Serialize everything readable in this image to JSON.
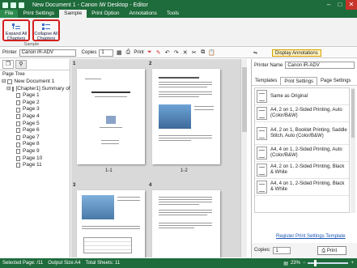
{
  "window": {
    "title": "New Document 1 - Canon iW Desktop - Editor",
    "minimize": "–",
    "maximize": "□",
    "close": "✕"
  },
  "ribbon_tabs": [
    "File",
    "Print Settings",
    "Sample",
    "Print Option",
    "Annotations",
    "Tools"
  ],
  "ribbon": {
    "expand_label": "Expand All Chapters",
    "collapse_label": "Collapse All Chapters",
    "group_label": "Sample"
  },
  "toolbar": {
    "printer_label": "Printer",
    "printer_value": "Canon iR-ADV",
    "copies_label": "Copies",
    "copies_value": "1",
    "print_label": "Print",
    "display_annotations": "Display Annotations"
  },
  "left_panel": {
    "title": "Page Tree",
    "tree": [
      {
        "label": "New Document 1",
        "level": 0
      },
      {
        "label": "[Chapter1] Summary of R",
        "level": 1
      },
      {
        "label": "Page 1",
        "level": 2
      },
      {
        "label": "Page 2",
        "level": 2
      },
      {
        "label": "Page 3",
        "level": 2
      },
      {
        "label": "Page 4",
        "level": 2
      },
      {
        "label": "Page 5",
        "level": 2
      },
      {
        "label": "Page 6",
        "level": 2
      },
      {
        "label": "Page 7",
        "level": 2
      },
      {
        "label": "Page 8",
        "level": 2
      },
      {
        "label": "Page 9",
        "level": 2
      },
      {
        "label": "Page 10",
        "level": 2
      },
      {
        "label": "Page 11",
        "level": 2
      }
    ]
  },
  "pages": [
    {
      "num": "1",
      "caption": "1-1",
      "heading": "Summary of Research"
    },
    {
      "num": "2",
      "caption": "1-2",
      "heading": "Introduction of Main Results"
    },
    {
      "num": "3",
      "caption": "",
      "heading": ""
    },
    {
      "num": "4",
      "caption": "",
      "heading": ""
    }
  ],
  "right_panel": {
    "printer_label": "Printer Name",
    "printer_value": "Canon iR-ADV",
    "tabs": [
      "Templates",
      "Print Settings",
      "Page Settings"
    ],
    "templates": [
      "Same as Original",
      "A4, 2 on 1, 2-Sided Printing, Auto (Color/B&W)",
      "A4, 2 on 1, Booklet Printing, Saddle Stitch, Auto (Color/B&W)",
      "A4, 4 on 1, 2-Sided Printing, Auto (Color/B&W)",
      "A4, 2 on 1, 2-Sided Printing, Black & White",
      "A4, 4 on 1, 2-Sided Printing, Black & White"
    ],
    "register_link": "Register Print Settings Template",
    "copies_label": "Copies:",
    "copies_value": "1",
    "print_button": "Print"
  },
  "status": {
    "selected": "Selected Page: /11",
    "output": "Output Size:A4",
    "total": "Total Sheets: 11",
    "zoom": "23%"
  },
  "colors": {
    "brand_green": "#1e6b3b",
    "highlight_red": "#d4201e",
    "link_blue": "#1a55b5"
  }
}
